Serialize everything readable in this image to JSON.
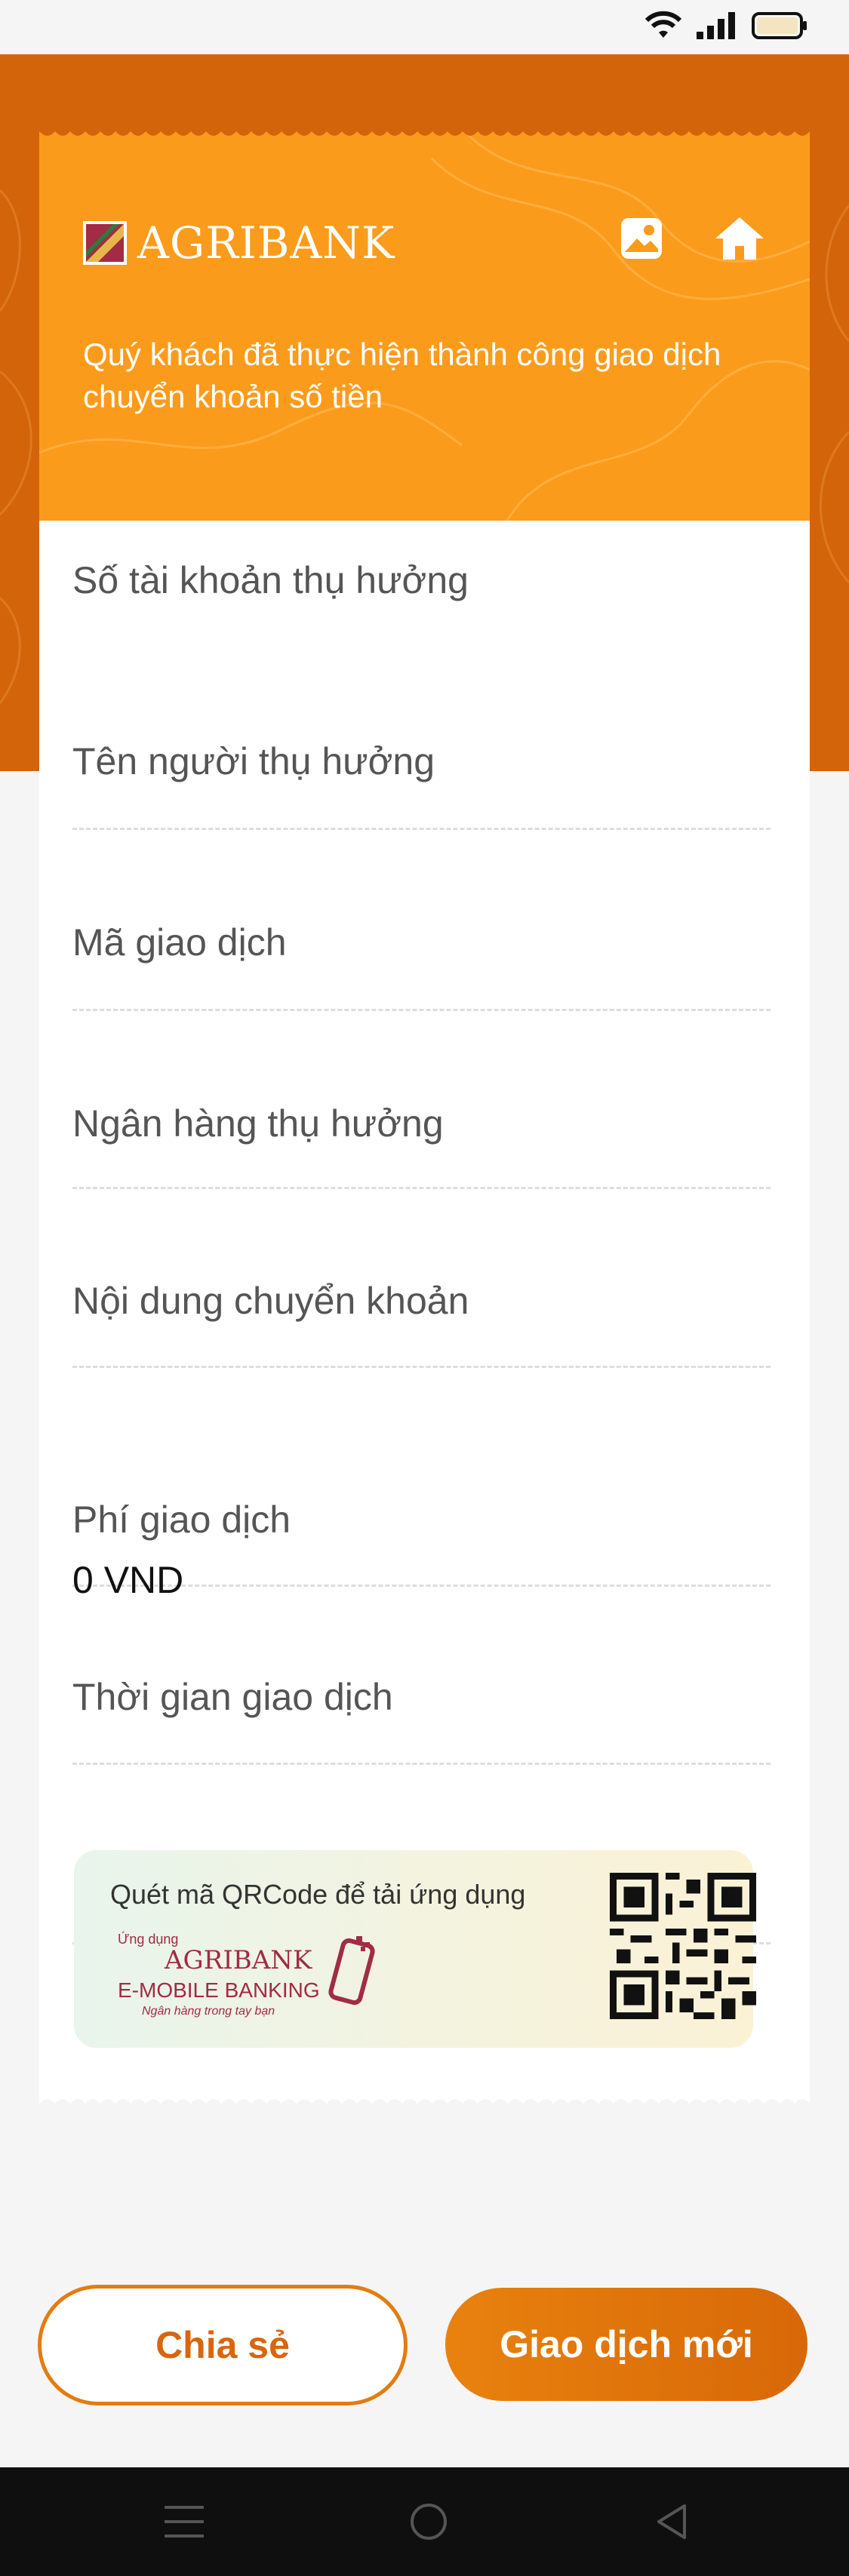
{
  "status_bar": {
    "icons": [
      "wifi-icon",
      "signal-icon",
      "battery-icon"
    ]
  },
  "header": {
    "brand": "AGRIBANK",
    "gallery_icon": "gallery-icon",
    "home_icon": "home-icon",
    "message": "Quý khách đã thực hiện thành công giao dịch chuyển khoản số tiền"
  },
  "fields": [
    {
      "label": "Số tài khoản thụ hưởng",
      "value": ""
    },
    {
      "label": "Tên người thụ hưởng",
      "value": ""
    },
    {
      "label": "Mã giao dịch",
      "value": ""
    },
    {
      "label": "Ngân hàng thụ hưởng",
      "value": ""
    },
    {
      "label": "Nội dung chuyển khoản",
      "value": ""
    },
    {
      "label": "Phí giao dịch",
      "value": "0 VND"
    },
    {
      "label": "Thời gian giao dịch",
      "value": ""
    }
  ],
  "qr_banner": {
    "title": "Quét mã QRCode để tải ứng dụng",
    "app_prefix": "Ứng dụng",
    "brand": "AGRIBANK",
    "product": "E-MOBILE BANKING",
    "tagline": "Ngân hàng trong tay bạn"
  },
  "actions": {
    "share_label": "Chia sẻ",
    "new_transaction_label": "Giao dịch mới"
  },
  "navbar": {
    "icons": [
      "menu-icon",
      "home-circle-icon",
      "back-icon"
    ]
  },
  "colors": {
    "orange_dark": "#d46409",
    "orange_header": "#fb9b1c",
    "button_orange": "#e37c10",
    "brand_red": "#a22b45"
  }
}
